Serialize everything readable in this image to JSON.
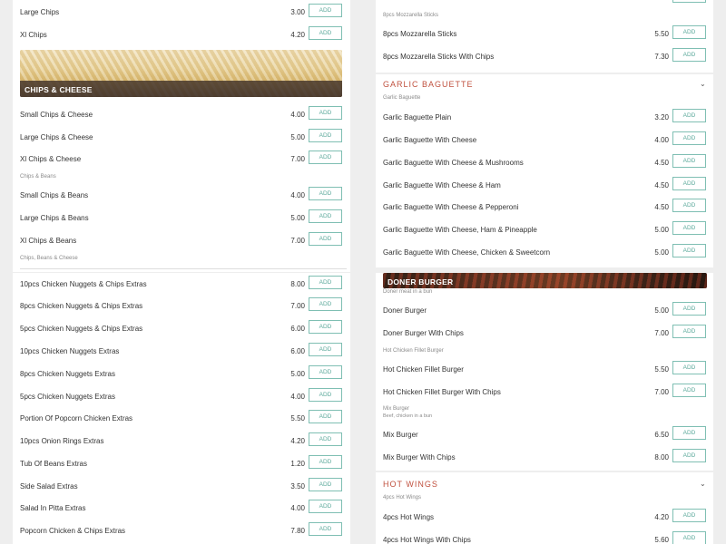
{
  "add_label": "ADD",
  "left_top": {
    "rows1": [
      {
        "name": "Large Chips",
        "price": "3.00"
      },
      {
        "name": "Xl Chips",
        "price": "4.20"
      }
    ],
    "banner_title": "CHIPS & CHEESE",
    "rows2": [
      {
        "name": "Small Chips & Cheese",
        "price": "4.00"
      },
      {
        "name": "Large Chips & Cheese",
        "price": "5.00"
      },
      {
        "name": "Xl Chips & Cheese",
        "price": "7.00"
      }
    ],
    "sub_beans": "Chips & Beans",
    "rows3": [
      {
        "name": "Small Chips & Beans",
        "price": "4.00"
      },
      {
        "name": "Large Chips & Beans",
        "price": "5.00"
      },
      {
        "name": "Xl Chips & Beans",
        "price": "7.00"
      }
    ],
    "sub_beans_cheese": "Chips, Beans & Cheese"
  },
  "right_top": {
    "sub_mozz": "8pcs Mozzarella Sticks",
    "rows1": [
      {
        "name": "8pcs Mozzarella Sticks",
        "price": "5.50"
      },
      {
        "name": "8pcs Mozzarella Sticks With Chips",
        "price": "7.30"
      }
    ],
    "section_title": "GARLIC BAGUETTE",
    "sub_garlic": "Garlic Baguette",
    "rows2": [
      {
        "name": "Garlic Baguette Plain",
        "price": "3.20"
      },
      {
        "name": "Garlic Baguette With Cheese",
        "price": "4.00"
      },
      {
        "name": "Garlic Baguette With Cheese & Mushrooms",
        "price": "4.50"
      },
      {
        "name": "Garlic Baguette With Cheese & Ham",
        "price": "4.50"
      },
      {
        "name": "Garlic Baguette With Cheese & Pepperoni",
        "price": "4.50"
      },
      {
        "name": "Garlic Baguette With Cheese, Ham & Pineapple",
        "price": "5.00"
      },
      {
        "name": "Garlic Baguette With Cheese, Chicken & Sweetcorn",
        "price": "5.00"
      }
    ]
  },
  "left_bottom": {
    "rows": [
      {
        "name": "10pcs Chicken Nuggets & Chips Extras",
        "price": "8.00"
      },
      {
        "name": "8pcs Chicken Nuggets & Chips Extras",
        "price": "7.00"
      },
      {
        "name": "5pcs Chicken Nuggets & Chips Extras",
        "price": "6.00"
      },
      {
        "name": "10pcs Chicken Nuggets Extras",
        "price": "6.00"
      },
      {
        "name": "8pcs Chicken Nuggets Extras",
        "price": "5.00"
      },
      {
        "name": "5pcs Chicken Nuggets Extras",
        "price": "4.00"
      },
      {
        "name": "Portion Of Popcorn Chicken Extras",
        "price": "5.50"
      },
      {
        "name": "10pcs Onion Rings Extras",
        "price": "4.20"
      },
      {
        "name": "Tub Of Beans Extras",
        "price": "1.20"
      },
      {
        "name": "Side Salad Extras",
        "price": "3.50"
      },
      {
        "name": "Salad In Pitta Extras",
        "price": "4.00"
      },
      {
        "name": "Popcorn Chicken & Chips Extras",
        "price": "7.80"
      }
    ]
  },
  "right_bottom": {
    "banner_title": "DONER BURGER",
    "sub_doner": "Doner meat in a bun",
    "rows1": [
      {
        "name": "Doner Burger",
        "price": "5.00"
      },
      {
        "name": "Doner Burger With Chips",
        "price": "7.00"
      }
    ],
    "sub_fillet": "Hot Chicken Fillet Burger",
    "rows2": [
      {
        "name": "Hot Chicken Fillet Burger",
        "price": "5.50"
      },
      {
        "name": "Hot Chicken Fillet Burger With Chips",
        "price": "7.00"
      }
    ],
    "sub_mix": "Mix Burger",
    "sub_mix_desc": "Beef, chicken in a bun",
    "rows3": [
      {
        "name": "Mix Burger",
        "price": "6.50"
      },
      {
        "name": "Mix Burger With Chips",
        "price": "8.00"
      }
    ],
    "section_title": "HOT WINGS",
    "sub_wings": "4pcs Hot Wings",
    "rows4": [
      {
        "name": "4pcs Hot Wings",
        "price": "4.20"
      },
      {
        "name": "4pcs Hot Wings With Chips",
        "price": "5.60"
      }
    ]
  },
  "icons": {
    "chevron": "chevron-down-icon"
  },
  "colors": {
    "accent": "#c0513f",
    "add_border": "#7fbfb3",
    "add_text": "#5aa89a"
  }
}
